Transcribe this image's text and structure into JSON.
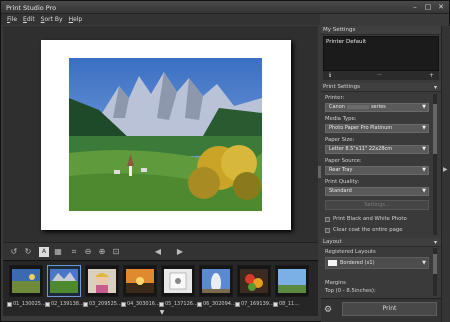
{
  "window": {
    "title": "Print Studio Pro"
  },
  "menu": [
    {
      "key": "F",
      "rest": "ile"
    },
    {
      "key": "E",
      "rest": "dit"
    },
    {
      "key": "S",
      "rest": "ort By"
    },
    {
      "key": "H",
      "rest": "elp"
    }
  ],
  "panel": {
    "my_settings_title": "My Settings",
    "my_settings_selected": "Printer Default",
    "print_settings_title": "Print Settings",
    "printer_label": "Printer:",
    "printer_value_a": "Canon",
    "printer_value_b": "series",
    "media_type_label": "Media Type:",
    "media_type_value": "Photo Paper Pro Platinum",
    "paper_size_label": "Paper Size:",
    "paper_size_value": "Letter 8.5\"x11\" 22x28cm",
    "paper_source_label": "Paper Source:",
    "paper_source_value": "Rear Tray",
    "print_quality_label": "Print Quality:",
    "print_quality_value": "Standard",
    "settings_button": "Settings...",
    "bw_label": "Print Black and White Photo",
    "clear_coat_label": "Clear coat the entire page",
    "layout_title": "Layout",
    "registered_layouts_label": "Registered Layouts",
    "layout_value": "Bordered (x1)",
    "margins_label": "Margins",
    "margins_value": "Top (0 - 8.5inches):",
    "print_button": "Print"
  },
  "filmstrip": [
    {
      "caption": "01_130025...",
      "checked": true
    },
    {
      "caption": "02_139138...",
      "checked": true
    },
    {
      "caption": "03_209525...",
      "checked": true
    },
    {
      "caption": "04_303016...",
      "checked": true
    },
    {
      "caption": "05_137126...",
      "checked": true
    },
    {
      "caption": "06_302094...",
      "checked": true
    },
    {
      "caption": "07_169139...",
      "checked": true
    },
    {
      "caption": "08_11...",
      "checked": true
    }
  ],
  "colors": {
    "accent": "#6a9bd8",
    "background": "#3a3a3a",
    "canvas": "#2f2f2f"
  }
}
